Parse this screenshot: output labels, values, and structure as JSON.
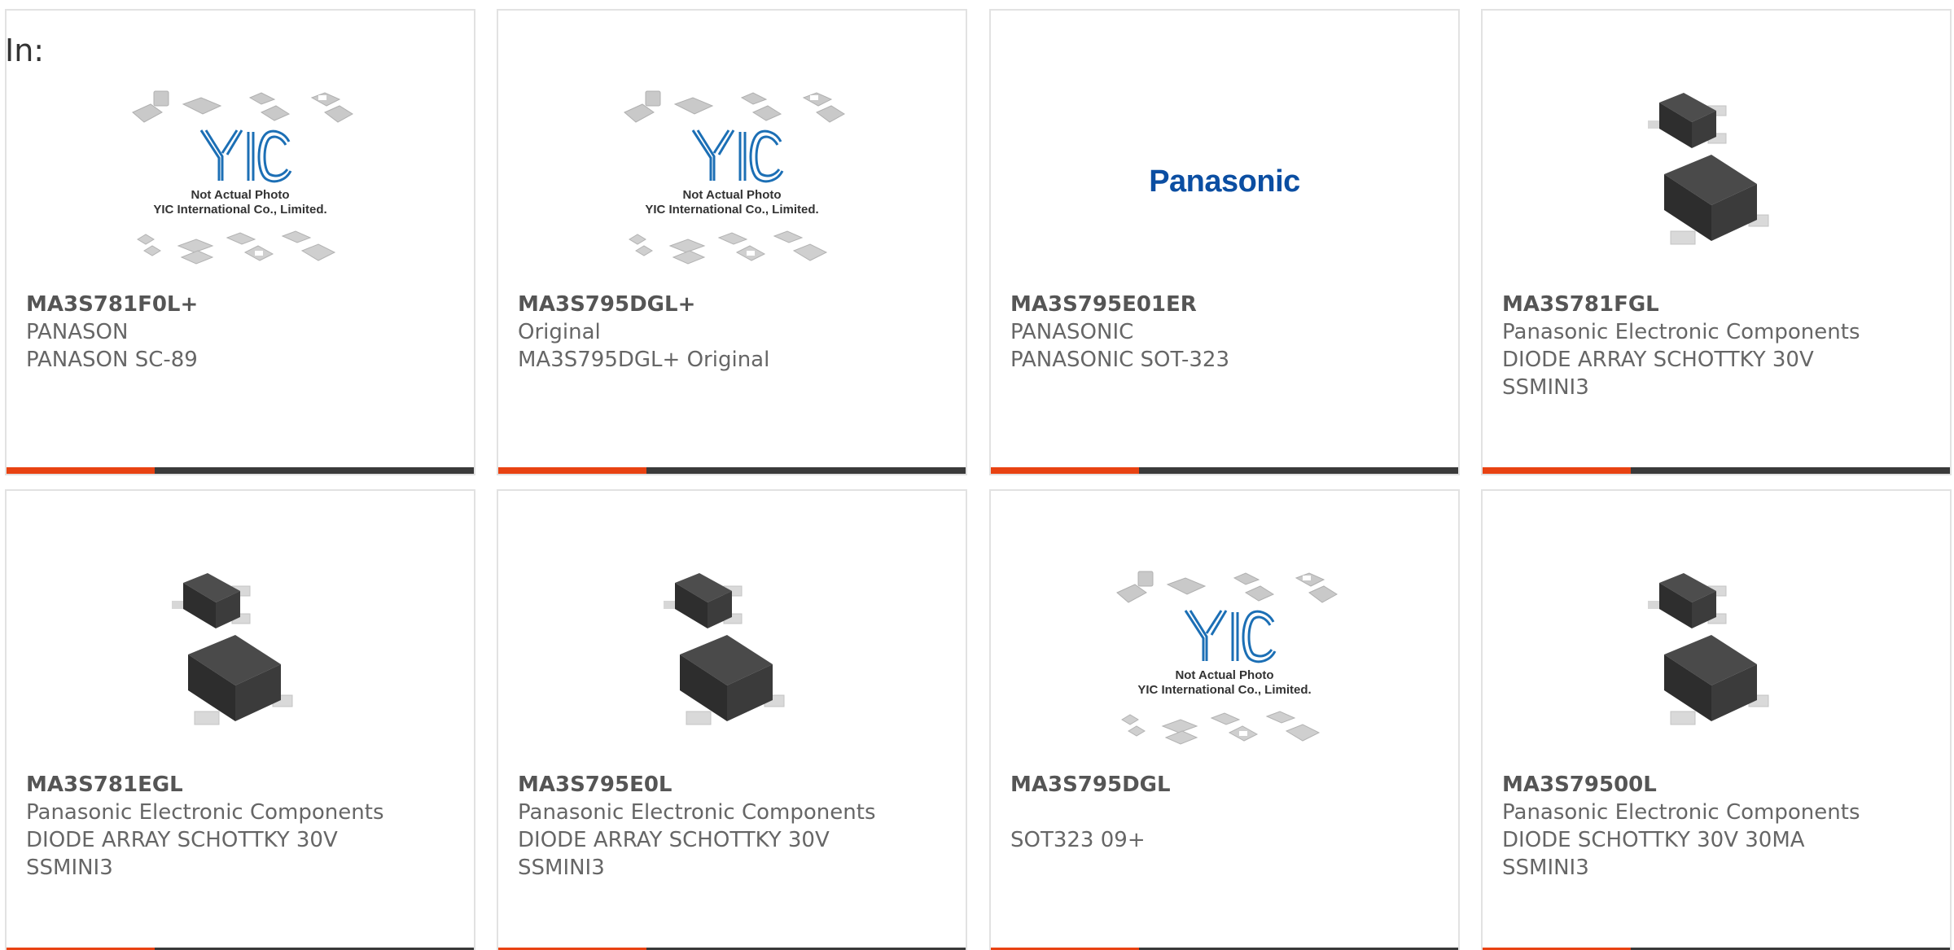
{
  "header": {
    "in_label": "In:"
  },
  "colors": {
    "accent": "#e84212",
    "bar": "#3a3a3a",
    "brand_blue": "#0b4ea2"
  },
  "placeholder": {
    "line1": "Not Actual Photo",
    "line2": "YIC International Co., Limited."
  },
  "brand_logo_text": "Panasonic",
  "products": [
    {
      "part": "MA3S781F0L+",
      "line1": "PANASON",
      "line2": "PANASON SC-89",
      "line3": "",
      "image": "yic-placeholder"
    },
    {
      "part": "MA3S795DGL+",
      "line1": "Original",
      "line2": "MA3S795DGL+ Original",
      "line3": "",
      "image": "yic-placeholder"
    },
    {
      "part": "MA3S795E01ER",
      "line1": "PANASONIC",
      "line2": "PANASONIC SOT-323",
      "line3": "",
      "image": "panasonic-logo"
    },
    {
      "part": "MA3S781FGL",
      "line1": "Panasonic Electronic Components",
      "line2": "DIODE ARRAY SCHOTTKY 30V",
      "line3": "SSMINI3",
      "image": "ssmini3-package"
    },
    {
      "part": "MA3S781EGL",
      "line1": "Panasonic Electronic Components",
      "line2": "DIODE ARRAY SCHOTTKY 30V",
      "line3": "SSMINI3",
      "image": "ssmini3-package"
    },
    {
      "part": "MA3S795E0L",
      "line1": "Panasonic Electronic Components",
      "line2": "DIODE ARRAY SCHOTTKY 30V",
      "line3": "SSMINI3",
      "image": "ssmini3-package"
    },
    {
      "part": "MA3S795DGL",
      "line1": "",
      "line2": "SOT323 09+",
      "line3": "",
      "image": "yic-placeholder"
    },
    {
      "part": "MA3S79500L",
      "line1": "Panasonic Electronic Components",
      "line2": "DIODE SCHOTTKY 30V 30MA",
      "line3": "SSMINI3",
      "image": "ssmini3-package"
    }
  ]
}
